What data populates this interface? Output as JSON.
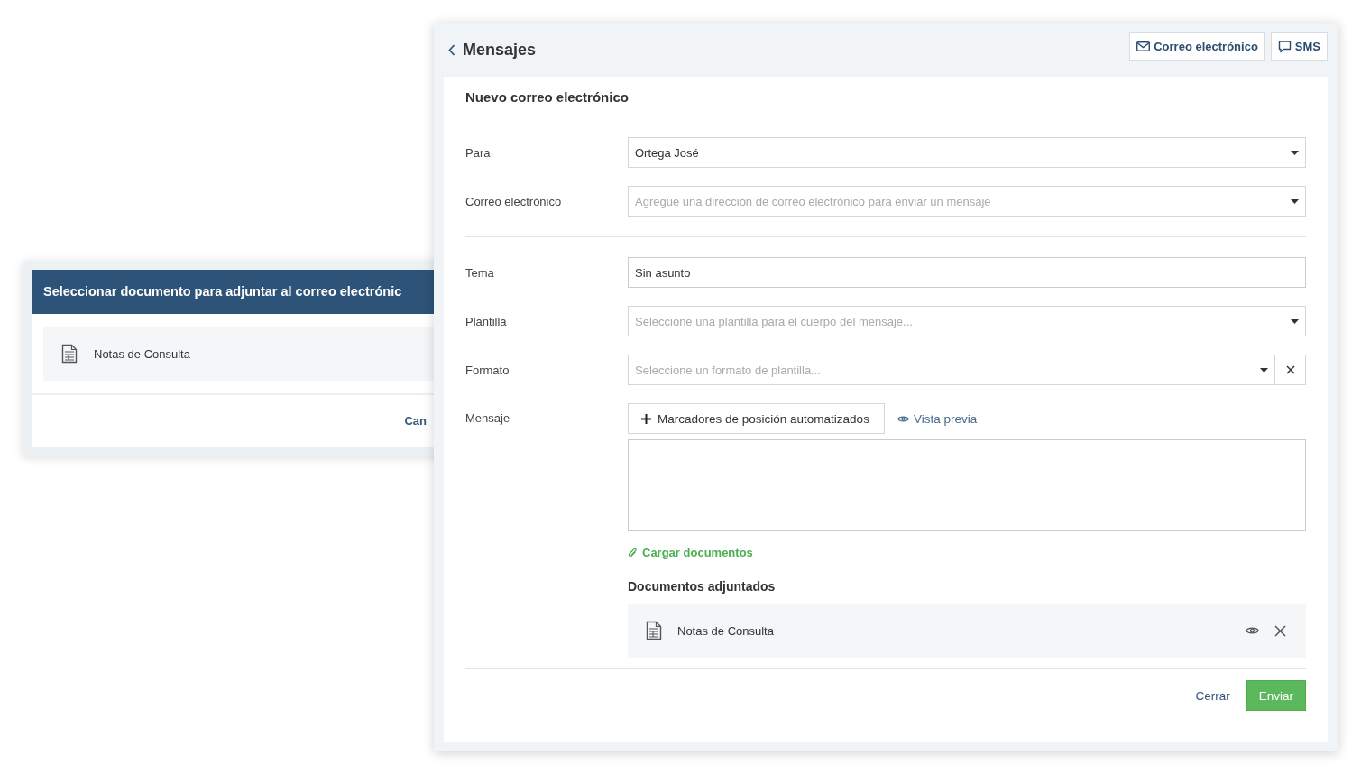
{
  "back_dialog": {
    "title": "Seleccionar documento para adjuntar al correo electrónic",
    "items": [
      {
        "name": "Notas de Consulta"
      }
    ],
    "cancel": "Can"
  },
  "panel": {
    "title": "Mensajes",
    "channels": [
      {
        "label": "Correo electrónico",
        "kind": "email"
      },
      {
        "label": "SMS",
        "kind": "sms"
      }
    ],
    "heading": "Nuevo correo electrónico",
    "recipients": [
      {
        "label": "Para",
        "kind": "select",
        "value": "Ortega José"
      },
      {
        "label": "Correo electrónico",
        "kind": "select",
        "placeholder": "Agregue una dirección de correo electrónico para enviar un mensaje"
      }
    ],
    "details": [
      {
        "label": "Tema",
        "kind": "text",
        "value": "Sin asunto"
      },
      {
        "label": "Plantilla",
        "kind": "select",
        "placeholder": "Seleccione una plantilla para el cuerpo del mensaje..."
      },
      {
        "label": "Formato",
        "kind": "select-clear",
        "placeholder": "Seleccione un formato de plantilla..."
      }
    ],
    "message": {
      "label": "Mensaje",
      "placeholders_button": "Marcadores de posición automatizados",
      "preview": "Vista previa",
      "upload": "Cargar documentos"
    },
    "attachments_title": "Documentos adjuntados",
    "attachments": [
      {
        "name": "Notas de Consulta"
      }
    ],
    "close": "Cerrar",
    "send": "Enviar"
  }
}
